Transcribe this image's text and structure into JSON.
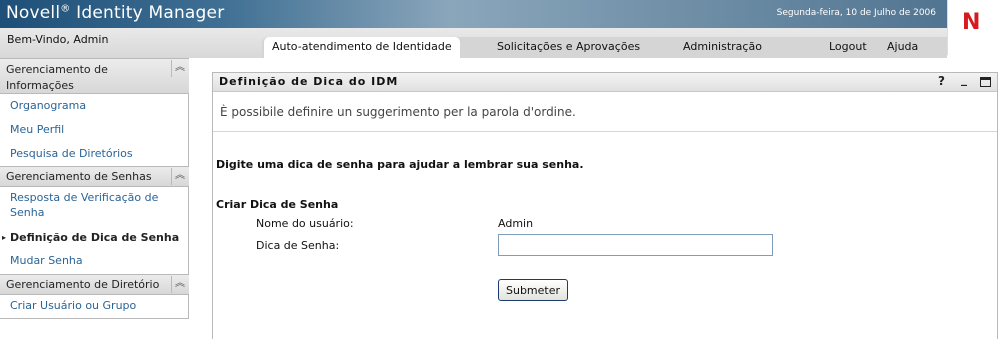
{
  "app": {
    "title": "Novell",
    "registered": "®",
    "title_rest": "Identity Manager",
    "date": "Segunda-feira, 10 de Julho de 2006",
    "logo_letter": "N",
    "welcome": "Bem-Vindo, Admin"
  },
  "tabs": [
    {
      "label": "Auto-atendimento de Identidade",
      "active": true
    },
    {
      "label": "Solicitações e Aprovações",
      "active": false
    },
    {
      "label": "Administração",
      "active": false
    }
  ],
  "header_links": {
    "logout": "Logout",
    "help": "Ajuda"
  },
  "sidebar": {
    "sections": [
      {
        "title": "Gerenciamento de Informações",
        "items": [
          "Organograma",
          "Meu Perfil",
          "Pesquisa de Diretórios"
        ]
      },
      {
        "title": "Gerenciamento de Senhas",
        "items": [
          "Resposta de Verificação de Senha",
          "Definição de Dica de Senha",
          "Mudar Senha"
        ]
      },
      {
        "title": "Gerenciamento de Diretório",
        "items": [
          "Criar Usuário ou Grupo"
        ]
      }
    ],
    "collapse_icon": "chevron-up-double-icon",
    "current_item": "Definição de Dica de Senha"
  },
  "portlet": {
    "title": "Definição de Dica do IDM",
    "help": "?",
    "minimize": "_",
    "description": "È possibile definire un suggerimento per la parola d'ordine."
  },
  "form": {
    "instruction": "Digite uma dica de senha para ajudar a lembrar sua senha.",
    "section_title": "Criar Dica de Senha",
    "username_label": "Nome do usuário:",
    "username_value": "Admin",
    "hint_label": "Dica de Senha:",
    "hint_value": "",
    "submit_label": "Submeter"
  },
  "colors": {
    "brand_red": "#d71920",
    "link": "#2a6496",
    "banner": "#1e4f78"
  }
}
